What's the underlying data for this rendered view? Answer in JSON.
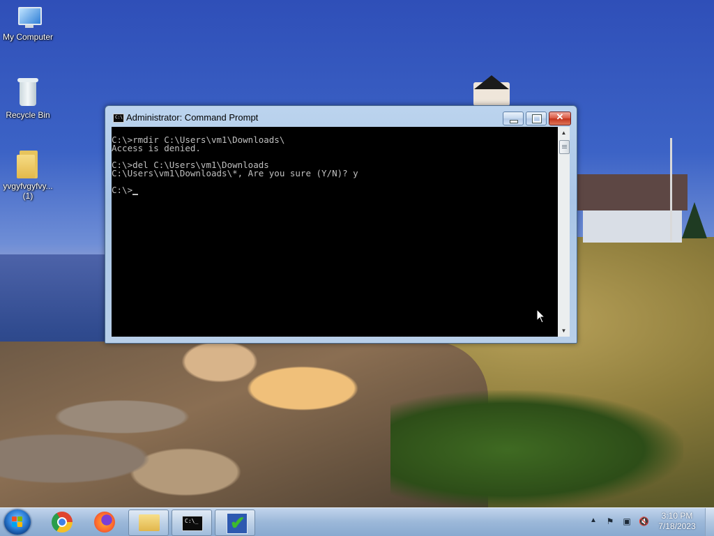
{
  "desktop": {
    "icons": [
      {
        "label": "My Computer",
        "icon": "computer-icon"
      },
      {
        "label": "Recycle Bin",
        "icon": "recycle-bin-icon"
      },
      {
        "label": "yvgyfvgyfvy...\n(1)",
        "label_line1": "yvgyfvgyfvy...",
        "label_line2": "(1)",
        "icon": "folder-icon"
      }
    ]
  },
  "cmd_window": {
    "title": "Administrator:  Command Prompt",
    "icon": "cmd-icon",
    "buttons": {
      "minimize": "minimize-icon",
      "maximize": "maximize-icon",
      "close": "✕"
    },
    "lines": [
      "C:\\>rmdir C:\\Users\\vm1\\Downloads\\",
      "Access is denied.",
      "",
      "C:\\>del C:\\Users\\vm1\\Downloads",
      "C:\\Users\\vm1\\Downloads\\*, Are you sure (Y/N)? y",
      "",
      "C:\\>"
    ]
  },
  "taskbar": {
    "start": "start-orb-icon",
    "pinned": [
      {
        "name": "chrome",
        "icon": "chrome-icon"
      },
      {
        "name": "firefox",
        "icon": "firefox-icon"
      },
      {
        "name": "explorer",
        "icon": "folder-icon"
      },
      {
        "name": "cmd",
        "icon": "cmd-icon"
      },
      {
        "name": "task",
        "icon": "checkmark-icon"
      }
    ],
    "tray": {
      "expand": "▲",
      "icons": [
        "action-center-flag-icon",
        "network-icon",
        "volume-muted-icon"
      ],
      "time": "3:10 PM",
      "date": "7/18/2023"
    }
  }
}
